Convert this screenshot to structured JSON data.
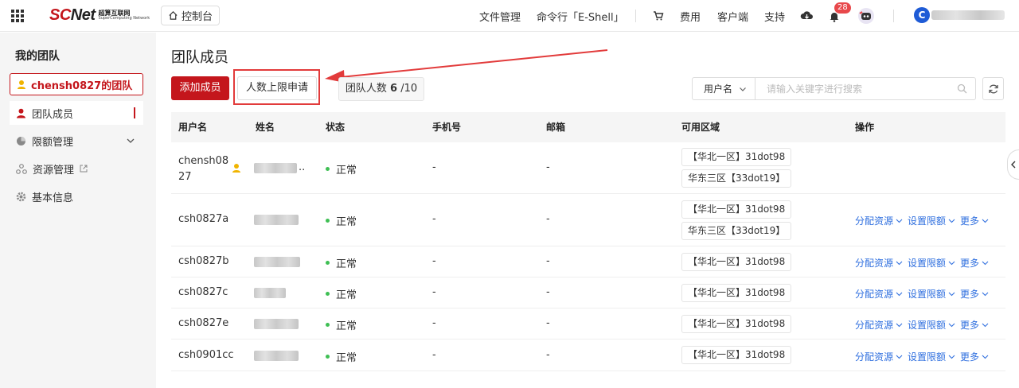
{
  "header": {
    "logo_main": "SC",
    "logo_main_b": "Net",
    "logo_sub_zh": "超算互联网",
    "logo_sub_en": "SuperComputing Network",
    "console": "控制台",
    "nav": [
      "文件管理",
      "命令行「E-Shell」",
      "费用",
      "客户端",
      "支持"
    ],
    "notification_count": "28",
    "user_initial": "C"
  },
  "sidebar": {
    "title": "我的团队",
    "team": "chensh0827的团队",
    "items": [
      {
        "label": "团队成员",
        "icon": "user-icon"
      },
      {
        "label": "限额管理",
        "icon": "pie-chart-icon"
      },
      {
        "label": "资源管理",
        "icon": "resource-icon"
      },
      {
        "label": "基本信息",
        "icon": "gear-icon"
      }
    ]
  },
  "main": {
    "title": "团队成员",
    "add_button": "添加成员",
    "limit_button": "人数上限申请",
    "count_label": "团队人数",
    "count_value": "6",
    "count_max": "/10",
    "search_type": "用户名",
    "search_placeholder": "请输入关键字进行搜索"
  },
  "table": {
    "headers": [
      "用户名",
      "姓名",
      "状态",
      "手机号",
      "邮箱",
      "可用区域",
      "操作"
    ],
    "rows": [
      {
        "username_l1": "chensh08",
        "username_l2": "27",
        "status": "正常",
        "phone": "-",
        "email": "-",
        "regions": [
          "【华北一区】31dot98",
          "华东三区【33dot19】"
        ],
        "ops": [],
        "name_suffix": ".."
      },
      {
        "username": "csh0827a",
        "status": "正常",
        "phone": "-",
        "email": "-",
        "regions": [
          "【华北一区】31dot98",
          "华东三区【33dot19】"
        ],
        "ops": [
          "分配资源",
          "设置限额",
          "更多"
        ]
      },
      {
        "username": "csh0827b",
        "status": "正常",
        "phone": "-",
        "email": "-",
        "regions": [
          "【华北一区】31dot98"
        ],
        "ops": [
          "分配资源",
          "设置限额",
          "更多"
        ]
      },
      {
        "username": "csh0827c",
        "status": "正常",
        "phone": "-",
        "email": "-",
        "regions": [
          "【华北一区】31dot98"
        ],
        "ops": [
          "分配资源",
          "设置限额",
          "更多"
        ]
      },
      {
        "username": "csh0827e",
        "status": "正常",
        "phone": "-",
        "email": "-",
        "regions": [
          "【华北一区】31dot98"
        ],
        "ops": [
          "分配资源",
          "设置限额",
          "更多"
        ]
      },
      {
        "username": "csh0901cc",
        "status": "正常",
        "phone": "-",
        "email": "-",
        "regions": [
          "【华北一区】31dot98"
        ],
        "ops": [
          "分配资源",
          "设置限额",
          "更多"
        ]
      }
    ]
  },
  "colors": {
    "brand": "#c4161c",
    "link": "#2f6fdf",
    "status_ok": "#3fbf54",
    "annotation": "#e23b3b"
  }
}
